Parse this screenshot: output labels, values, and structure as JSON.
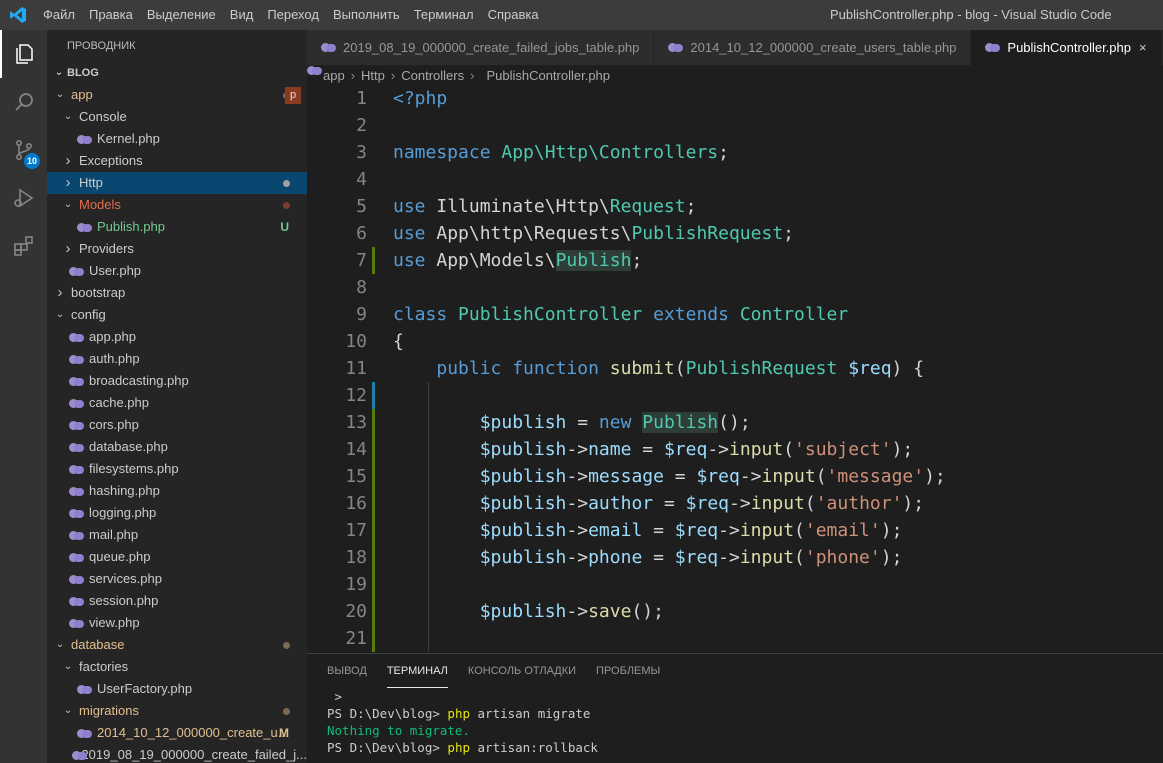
{
  "titlebar": {
    "menu": [
      "Файл",
      "Правка",
      "Выделение",
      "Вид",
      "Переход",
      "Выполнить",
      "Терминал",
      "Справка"
    ],
    "title": "PublishController.php - blog - Visual Studio Code"
  },
  "activity": {
    "scm_badge": "10"
  },
  "sidebar": {
    "explorer_title": "ПРОВОДНИК",
    "section": "BLOG",
    "tree": [
      {
        "label": "app",
        "type": "folder",
        "open": true,
        "indent": 1,
        "color": "#e2c08d",
        "dot": "#7c6a55",
        "badge": "p"
      },
      {
        "label": "Console",
        "type": "folder",
        "open": true,
        "indent": 2
      },
      {
        "label": "Kernel.php",
        "type": "file",
        "indent": 3
      },
      {
        "label": "Exceptions",
        "type": "folder",
        "open": false,
        "indent": 2
      },
      {
        "label": "Http",
        "type": "folder",
        "open": false,
        "indent": 2,
        "selected": true,
        "dot": "#a0a0a0"
      },
      {
        "label": "Models",
        "type": "folder",
        "open": true,
        "indent": 2,
        "color": "#e86b4b",
        "dot": "#7a3d33"
      },
      {
        "label": "Publish.php",
        "type": "file",
        "indent": 3,
        "color": "#73c991",
        "deco": "U",
        "deco_color": "#73c991"
      },
      {
        "label": "Providers",
        "type": "folder",
        "open": false,
        "indent": 2
      },
      {
        "label": "User.php",
        "type": "file",
        "indent": 2
      },
      {
        "label": "bootstrap",
        "type": "folder",
        "open": false,
        "indent": 1
      },
      {
        "label": "config",
        "type": "folder",
        "open": true,
        "indent": 1
      },
      {
        "label": "app.php",
        "type": "file",
        "indent": 2
      },
      {
        "label": "auth.php",
        "type": "file",
        "indent": 2
      },
      {
        "label": "broadcasting.php",
        "type": "file",
        "indent": 2
      },
      {
        "label": "cache.php",
        "type": "file",
        "indent": 2
      },
      {
        "label": "cors.php",
        "type": "file",
        "indent": 2
      },
      {
        "label": "database.php",
        "type": "file",
        "indent": 2
      },
      {
        "label": "filesystems.php",
        "type": "file",
        "indent": 2
      },
      {
        "label": "hashing.php",
        "type": "file",
        "indent": 2
      },
      {
        "label": "logging.php",
        "type": "file",
        "indent": 2
      },
      {
        "label": "mail.php",
        "type": "file",
        "indent": 2
      },
      {
        "label": "queue.php",
        "type": "file",
        "indent": 2
      },
      {
        "label": "services.php",
        "type": "file",
        "indent": 2
      },
      {
        "label": "session.php",
        "type": "file",
        "indent": 2
      },
      {
        "label": "view.php",
        "type": "file",
        "indent": 2
      },
      {
        "label": "database",
        "type": "folder",
        "open": true,
        "indent": 1,
        "color": "#e2c08d",
        "dot": "#7c6a55"
      },
      {
        "label": "factories",
        "type": "folder",
        "open": true,
        "indent": 2
      },
      {
        "label": "UserFactory.php",
        "type": "file",
        "indent": 3
      },
      {
        "label": "migrations",
        "type": "folder",
        "open": true,
        "indent": 2,
        "color": "#e2c08d",
        "dot": "#7c6a55"
      },
      {
        "label": "2014_10_12_000000_create_u...",
        "type": "file",
        "indent": 3,
        "color": "#e2c08d",
        "deco": "M",
        "deco_color": "#e2c08d"
      },
      {
        "label": "2019_08_19_000000_create_failed_j...",
        "type": "file",
        "indent": 3
      }
    ]
  },
  "tabs": [
    {
      "label": "2019_08_19_000000_create_failed_jobs_table.php",
      "active": false
    },
    {
      "label": "2014_10_12_000000_create_users_table.php",
      "active": false
    },
    {
      "label": "PublishController.php",
      "active": true
    }
  ],
  "breadcrumb": [
    "app",
    "Http",
    "Controllers",
    "PublishController.php"
  ],
  "code": [
    {
      "n": "1",
      "tokens": [
        [
          "k",
          "<?php"
        ]
      ]
    },
    {
      "n": "2",
      "tokens": []
    },
    {
      "n": "3",
      "tokens": [
        [
          "k",
          "namespace "
        ],
        [
          "t",
          "App\\Http\\Controllers"
        ],
        [
          "p",
          ";"
        ]
      ]
    },
    {
      "n": "4",
      "tokens": []
    },
    {
      "n": "5",
      "tokens": [
        [
          "k",
          "use "
        ],
        [
          "p",
          "Illuminate\\Http\\"
        ],
        [
          "t",
          "Request"
        ],
        [
          "p",
          ";"
        ]
      ]
    },
    {
      "n": "6",
      "tokens": [
        [
          "k",
          "use "
        ],
        [
          "p",
          "App\\http\\Requests\\"
        ],
        [
          "t",
          "PublishRequest"
        ],
        [
          "p",
          ";"
        ]
      ]
    },
    {
      "n": "7",
      "tokens": [
        [
          "k",
          "use "
        ],
        [
          "p",
          "App\\Models\\"
        ],
        [
          "t hl",
          "Publish"
        ],
        [
          "p",
          ";"
        ]
      ],
      "mod": "#587c0c"
    },
    {
      "n": "8",
      "tokens": []
    },
    {
      "n": "9",
      "tokens": [
        [
          "k",
          "class "
        ],
        [
          "t",
          "PublishController "
        ],
        [
          "k",
          "extends "
        ],
        [
          "t",
          "Controller"
        ]
      ]
    },
    {
      "n": "10",
      "tokens": [
        [
          "p",
          "{"
        ]
      ]
    },
    {
      "n": "11",
      "tokens": [
        [
          "p",
          "    "
        ],
        [
          "k",
          "public function "
        ],
        [
          "f",
          "submit"
        ],
        [
          "p",
          "("
        ],
        [
          "t",
          "PublishRequest "
        ],
        [
          "v",
          "$req"
        ],
        [
          "p",
          ") {"
        ]
      ]
    },
    {
      "n": "12",
      "tokens": [],
      "mod": "#1b81a8"
    },
    {
      "n": "13",
      "tokens": [
        [
          "p",
          "        "
        ],
        [
          "v",
          "$publish"
        ],
        [
          "p",
          " = "
        ],
        [
          "k",
          "new "
        ],
        [
          "t hl",
          "Publish"
        ],
        [
          "p",
          "();"
        ]
      ],
      "mod": "#587c0c"
    },
    {
      "n": "14",
      "tokens": [
        [
          "p",
          "        "
        ],
        [
          "v",
          "$publish"
        ],
        [
          "p",
          "->"
        ],
        [
          "v",
          "name"
        ],
        [
          "p",
          " = "
        ],
        [
          "v",
          "$req"
        ],
        [
          "p",
          "->"
        ],
        [
          "f",
          "input"
        ],
        [
          "p",
          "("
        ],
        [
          "s",
          "'subject'"
        ],
        [
          "p",
          ");"
        ]
      ],
      "mod": "#587c0c"
    },
    {
      "n": "15",
      "tokens": [
        [
          "p",
          "        "
        ],
        [
          "v",
          "$publish"
        ],
        [
          "p",
          "->"
        ],
        [
          "v",
          "message"
        ],
        [
          "p",
          " = "
        ],
        [
          "v",
          "$req"
        ],
        [
          "p",
          "->"
        ],
        [
          "f",
          "input"
        ],
        [
          "p",
          "("
        ],
        [
          "s",
          "'message'"
        ],
        [
          "p",
          ");"
        ]
      ],
      "mod": "#587c0c"
    },
    {
      "n": "16",
      "tokens": [
        [
          "p",
          "        "
        ],
        [
          "v",
          "$publish"
        ],
        [
          "p",
          "->"
        ],
        [
          "v",
          "author"
        ],
        [
          "p",
          " = "
        ],
        [
          "v",
          "$req"
        ],
        [
          "p",
          "->"
        ],
        [
          "f",
          "input"
        ],
        [
          "p",
          "("
        ],
        [
          "s",
          "'author'"
        ],
        [
          "p",
          ");"
        ]
      ],
      "mod": "#587c0c"
    },
    {
      "n": "17",
      "tokens": [
        [
          "p",
          "        "
        ],
        [
          "v",
          "$publish"
        ],
        [
          "p",
          "->"
        ],
        [
          "v",
          "email"
        ],
        [
          "p",
          " = "
        ],
        [
          "v",
          "$req"
        ],
        [
          "p",
          "->"
        ],
        [
          "f",
          "input"
        ],
        [
          "p",
          "("
        ],
        [
          "s",
          "'email'"
        ],
        [
          "p",
          ");"
        ]
      ],
      "mod": "#587c0c"
    },
    {
      "n": "18",
      "tokens": [
        [
          "p",
          "        "
        ],
        [
          "v",
          "$publish"
        ],
        [
          "p",
          "->"
        ],
        [
          "v",
          "phone"
        ],
        [
          "p",
          " = "
        ],
        [
          "v",
          "$req"
        ],
        [
          "p",
          "->"
        ],
        [
          "f",
          "input"
        ],
        [
          "p",
          "("
        ],
        [
          "s",
          "'phone'"
        ],
        [
          "p",
          ");"
        ]
      ],
      "mod": "#587c0c"
    },
    {
      "n": "19",
      "tokens": [],
      "mod": "#587c0c"
    },
    {
      "n": "20",
      "tokens": [
        [
          "p",
          "        "
        ],
        [
          "v",
          "$publish"
        ],
        [
          "p",
          "->"
        ],
        [
          "f",
          "save"
        ],
        [
          "p",
          "();"
        ]
      ],
      "mod": "#587c0c"
    },
    {
      "n": "21",
      "tokens": [],
      "mod": "#587c0c"
    }
  ],
  "panel": {
    "tabs": [
      {
        "label": "ВЫВОД",
        "active": false
      },
      {
        "label": "ТЕРМИНАЛ",
        "active": true
      },
      {
        "label": "КОНСОЛЬ ОТЛАДКИ",
        "active": false
      },
      {
        "label": "ПРОБЛЕМЫ",
        "active": false
      }
    ],
    "terminal": [
      {
        "prompt": " > ",
        "cmd": "",
        "rest": ""
      },
      {
        "prompt": "PS D:\\Dev\\blog> ",
        "cmd": "php",
        "rest": " artisan migrate"
      },
      {
        "prompt": "",
        "cmd": "",
        "rest": "",
        "green": "Nothing to migrate."
      },
      {
        "prompt": "PS D:\\Dev\\blog> ",
        "cmd": "php",
        "rest": " artisan:rollback"
      }
    ]
  }
}
